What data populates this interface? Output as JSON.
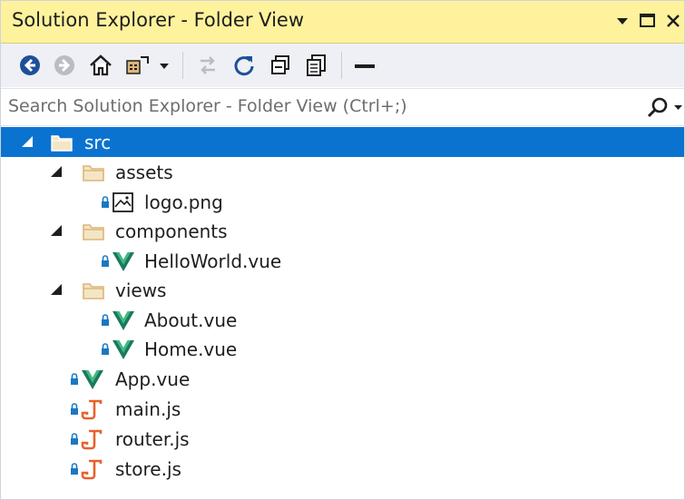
{
  "window": {
    "title": "Solution Explorer - Folder View"
  },
  "search": {
    "placeholder": "Search Solution Explorer - Folder View (Ctrl+;)"
  },
  "tree": {
    "src": "src",
    "assets": "assets",
    "logo_png": "logo.png",
    "components": "components",
    "helloworld_vue": "HelloWorld.vue",
    "views": "views",
    "about_vue": "About.vue",
    "home_vue": "Home.vue",
    "app_vue": "App.vue",
    "main_js": "main.js",
    "router_js": "router.js",
    "store_js": "store.js"
  },
  "colors": {
    "title_bar": "#fff29d",
    "selection": "#0a73d0",
    "vue_green": "#41b883",
    "js_orange": "#e8612b",
    "folder": "#dcb67a"
  }
}
